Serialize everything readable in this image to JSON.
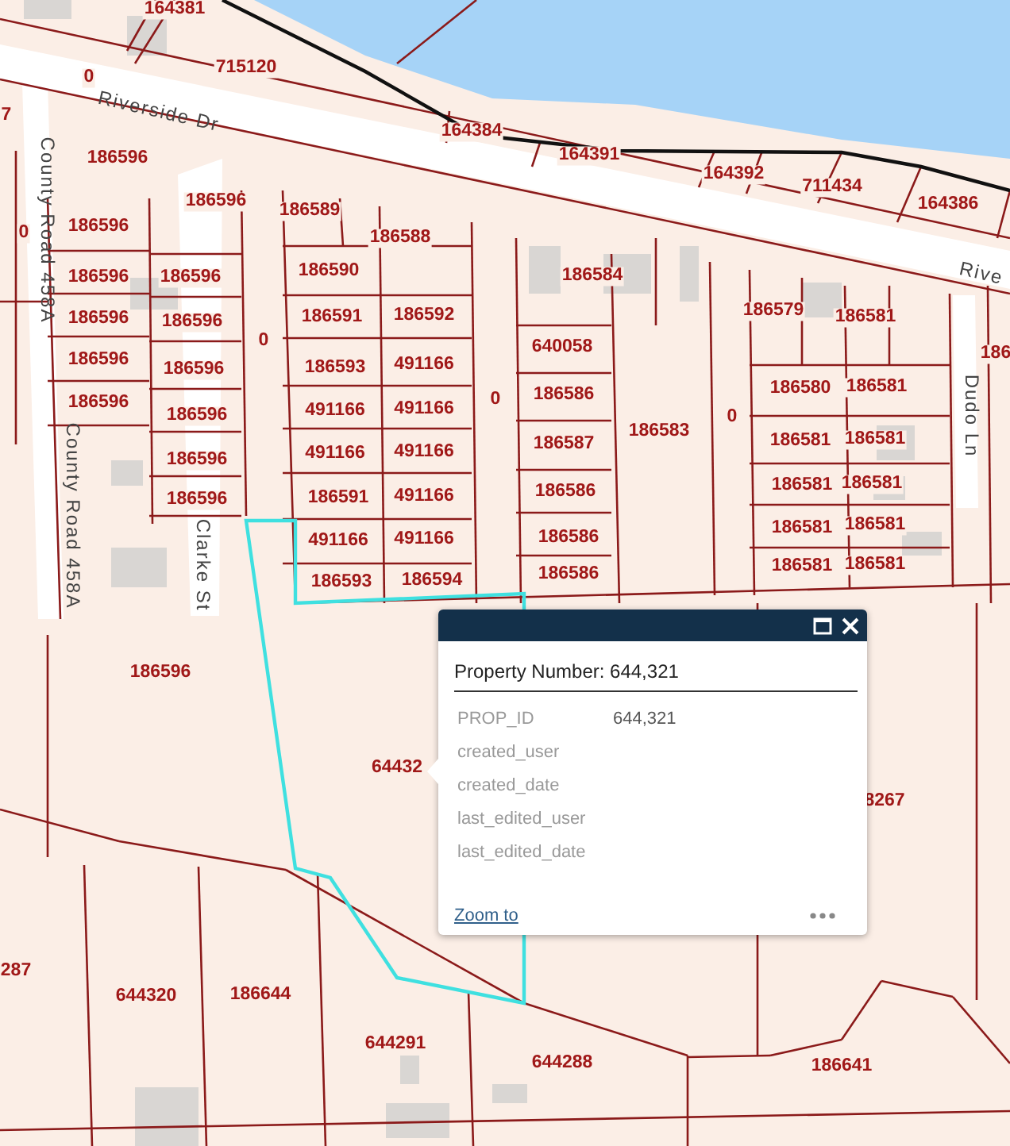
{
  "map": {
    "road_labels": [
      {
        "text": "Riverside Dr",
        "kind": "sloped"
      },
      {
        "text": "Rive",
        "kind": "sloped"
      },
      {
        "text": "County Road 458A",
        "kind": "vertical"
      },
      {
        "text": "County Road 458A",
        "kind": "vertical"
      },
      {
        "text": "Clarke St",
        "kind": "vertical"
      },
      {
        "text": "Dudo Ln",
        "kind": "vertical"
      }
    ],
    "parcel_labels": [
      "164381",
      "715120",
      "0",
      "7",
      "164384",
      "164391",
      "164392",
      "711434",
      "164386",
      "186596",
      "186596",
      "186589",
      "186588",
      "0",
      "186596",
      "186596",
      "186596",
      "186590",
      "186584",
      "186579",
      "186581",
      "186",
      "186596",
      "186596",
      "186591",
      "186592",
      "0",
      "186596",
      "186596",
      "186593",
      "491166",
      "0",
      "640058",
      "186580",
      "186581",
      "186596",
      "186596",
      "491166",
      "491166",
      "186586",
      "186583",
      "0",
      "186581",
      "186581",
      "186596",
      "491166",
      "491166",
      "186587",
      "186596",
      "186591",
      "491166",
      "186586",
      "186581",
      "186581",
      "491166",
      "491166",
      "186586",
      "186581",
      "186581",
      "186593",
      "186594",
      "186586",
      "186581",
      "186581",
      "186596",
      "64432",
      "8267",
      "287",
      "644320",
      "186644",
      "644291",
      "644288",
      "186641"
    ]
  },
  "popup": {
    "title": "Property Number: 644,321",
    "fields": [
      {
        "name": "PROP_ID",
        "value": "644,321"
      },
      {
        "name": "created_user"
      },
      {
        "name": "created_date"
      },
      {
        "name": "last_edited_user"
      },
      {
        "name": "last_edited_date"
      }
    ],
    "link": "Zoom to"
  }
}
